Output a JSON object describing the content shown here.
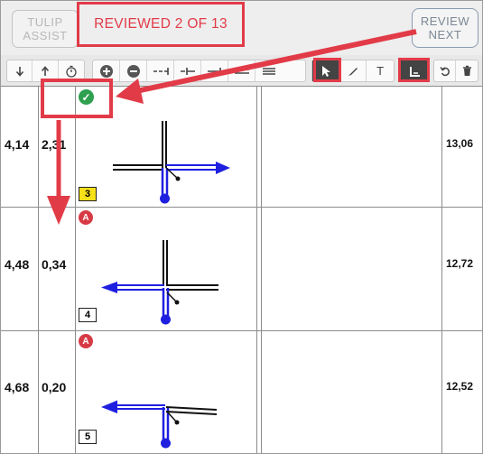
{
  "header": {
    "tulip_assist_line1": "TULIP",
    "tulip_assist_line2": "ASSIST",
    "review_status": "REVIEWED 2 OF 13",
    "review_next_line1": "REVIEW",
    "review_next_line2": "NEXT"
  },
  "toolbar": {
    "icons": [
      "arrow-down-icon",
      "arrow-up-icon",
      "stopwatch-icon",
      "add-circle-icon",
      "remove-circle-icon",
      "split-left-icon",
      "split-center-icon",
      "split-right-icon",
      "merge-left-icon",
      "merge-right-icon",
      "pointer-icon",
      "pen-icon",
      "text-icon",
      "dimension-icon",
      "undo-icon",
      "trash-icon"
    ],
    "text_tool_label": "T"
  },
  "rows": [
    {
      "col_a": "4,14",
      "col_b": "2,31",
      "status": "check",
      "step": "3",
      "step_color": "#f7e01a",
      "col_end": "13,06",
      "direction": "right"
    },
    {
      "col_a": "4,48",
      "col_b": "0,34",
      "status": "alert",
      "alert_label": "A",
      "step": "4",
      "step_color": "#ffffff",
      "col_end": "12,72",
      "direction": "left"
    },
    {
      "col_a": "4,68",
      "col_b": "0,20",
      "status": "alert",
      "alert_label": "A",
      "step": "5",
      "step_color": "#ffffff",
      "col_end": "12,52",
      "direction": "left"
    }
  ],
  "colors": {
    "accent": "#e23b48",
    "route": "#1f1fe0",
    "ok": "#2ea04f",
    "alert": "#d63a45",
    "step_highlight": "#f7e01a"
  }
}
